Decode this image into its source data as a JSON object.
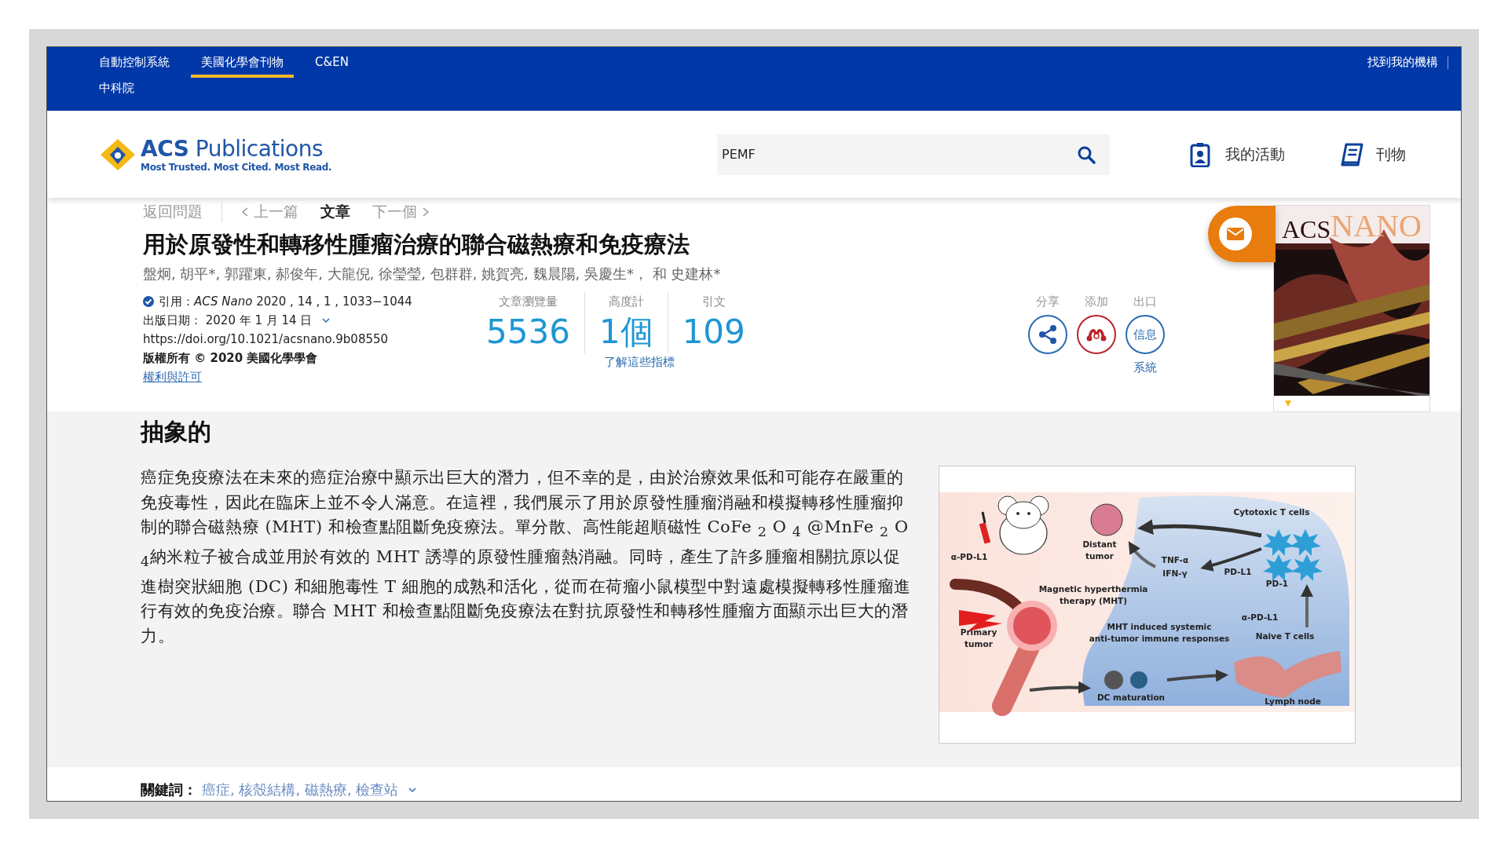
{
  "top_bar": {
    "links": [
      {
        "label": "自動控制系統",
        "selected": false
      },
      {
        "label": "美國化學會刊物",
        "selected": true
      },
      {
        "label": "C&EN",
        "selected": false
      }
    ],
    "second_row": "中科院",
    "institution_link": "找到我的機構"
  },
  "header": {
    "logo": {
      "wordmark": "**ACS** Publications",
      "tagline": "Most Trusted. Most Cited. Most Read."
    },
    "search": {
      "value": "PEMF"
    },
    "links": [
      {
        "kind": "activity",
        "label": "我的活動"
      },
      {
        "kind": "publications",
        "label": "刊物"
      }
    ]
  },
  "article_nav": {
    "back": "返回問題",
    "items": [
      {
        "kind": "prev",
        "label": "上一篇",
        "selected": false
      },
      {
        "kind": "current",
        "label": "文章",
        "selected": true
      },
      {
        "kind": "next",
        "label": "下一個",
        "selected": false
      }
    ]
  },
  "title": "用於原發性和轉移性腫瘤治療的聯合磁熱療和免疫療法",
  "authors": "盤炯, 胡平*, 郭躍東, 郝俊年, 大龍倪, 徐瑩瑩, 包群群, 姚賀亮, 魏晨陽, 吳慶生*， 和 史建林*",
  "meta": {
    "citation": "引用：*ACS Nano*  2020 , 14 , 1 , 1033−1044",
    "published": "出版日期： 2020 年 1 月 14 日",
    "doi": "https://doi.org/10.1021/acsnano.9b08550",
    "copyright": "版權所有 © 2020 美國化學學會",
    "permissions": "權利與許可"
  },
  "metrics": [
    {
      "label": "文章瀏覽量",
      "value": "5536"
    },
    {
      "label": "高度計",
      "value": "1個"
    },
    {
      "label": "引文",
      "value": "109"
    }
  ],
  "metrics_link": "了解這些指標",
  "actions": [
    {
      "kind": "share",
      "label": "分享"
    },
    {
      "kind": "mendeley",
      "label": "添加"
    },
    {
      "kind": "export",
      "label": "出口",
      "icon_text": "信息",
      "caption": "系統"
    }
  ],
  "cover": {
    "title_parts": [
      "ACS",
      "NANO"
    ]
  },
  "abstract": {
    "heading": "抽象的",
    "text": "癌症免疫療法在未來的癌症治療中顯示出巨大的潛力，但不幸的是，由於治療效果低和可能存在嚴重的免疫毒性，因此在臨床上並不令人滿意。在這裡，我們展示了用於原發性腫瘤消融和模擬轉移性腫瘤抑制的聯合磁熱療 (MHT) 和檢查點阻斷免疫療法。單分散、高性能超順磁性 CoFe $_{2}$ O $_{4}$ @MnFe $_{2}$ O $_{4}$納米粒子被合成並用於有效的 MHT 誘導的原發性腫瘤熱消融。同時，產生了許多腫瘤相關抗原以促進樹突狀細胞 (DC) 和細胞毒性 T 細胞的成熟和活化，從而在荷瘤小鼠模型中對遠處模擬轉移性腫瘤進行有效的免疫治療。聯合 MHT 和檢查點阻斷免疫療法在對抗原發性和轉移性腫瘤方面顯示出巨大的潛力。",
    "figure": {
      "labels": [
        {
          "lines": [
            "α-PD-L1"
          ]
        },
        {
          "lines": [
            "Distant",
            "tumor"
          ]
        },
        {
          "lines": [
            "Cytotoxic T cells"
          ]
        },
        {
          "lines": [
            "TNF-α"
          ]
        },
        {
          "lines": [
            "IFN-γ"
          ]
        },
        {
          "lines": [
            "PD-L1"
          ]
        },
        {
          "lines": [
            "PD-1"
          ]
        },
        {
          "lines": [
            "Magnetic hyperthermia",
            "therapy (MHT)"
          ]
        },
        {
          "lines": [
            "Primary",
            "tumor"
          ]
        },
        {
          "lines": [
            "α-PD-L1"
          ]
        },
        {
          "lines": [
            "MHT induced systemic",
            "anti-tumor immune responses"
          ]
        },
        {
          "lines": [
            "Naive T cells"
          ]
        },
        {
          "lines": [
            "DC maturation"
          ]
        },
        {
          "lines": [
            "Lymph node"
          ]
        }
      ]
    }
  },
  "keywords": {
    "label": "關鍵詞：",
    "items": "癌症, 核殼結構, 磁熱療, 檢查站"
  }
}
